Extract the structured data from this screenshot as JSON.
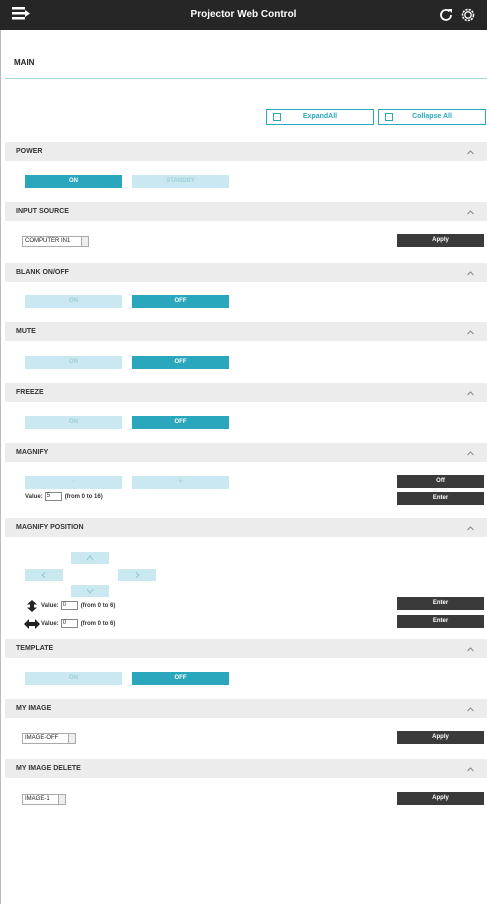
{
  "app": {
    "title": "Projector Web Control"
  },
  "main": {
    "label": "MAIN",
    "expand_all": "ExpandAll",
    "collapse_all": "Collapse All"
  },
  "sections": {
    "power": {
      "label": "POWER",
      "on": "ON",
      "standby": "STANDBY"
    },
    "input_source": {
      "label": "INPUT SOURCE",
      "selected": "COMPUTER IN1",
      "apply": "Apply"
    },
    "blank": {
      "label": "BLANK ON/OFF",
      "on": "ON",
      "off": "OFF"
    },
    "mute": {
      "label": "MUTE",
      "on": "ON",
      "off": "OFF"
    },
    "freeze": {
      "label": "FREEZE",
      "on": "ON",
      "off": "OFF"
    },
    "magnify": {
      "label": "MAGNIFY",
      "minus": "-",
      "plus": "+",
      "value_label": "Value:",
      "value": "5",
      "range": "(from 0 to 16)",
      "off_btn": "Off",
      "enter": "Enter"
    },
    "magnify_position": {
      "label": "MAGNIFY POSITION",
      "value_label": "Value:",
      "v_value": "0",
      "h_value": "0",
      "range": "(from 0 to 6)",
      "enter": "Enter"
    },
    "template": {
      "label": "TEMPLATE",
      "on": "ON",
      "off": "OFF"
    },
    "my_image": {
      "label": "MY IMAGE",
      "selected": "IMAGE-OFF",
      "apply": "Apply"
    },
    "my_image_delete": {
      "label": "MY IMAGE DELETE",
      "selected": "IMAGE-1",
      "apply": "Apply"
    }
  },
  "colors": {
    "accent": "#2aa7bd",
    "accent_light": "#c9e8ef",
    "topbar": "#262626",
    "dark_button": "#3a3a3a",
    "section_header": "#ececec"
  },
  "icons": {
    "menu": "menu-icon",
    "refresh": "refresh-icon",
    "settings": "gear-icon",
    "collapse": "chevron-up-icon"
  }
}
